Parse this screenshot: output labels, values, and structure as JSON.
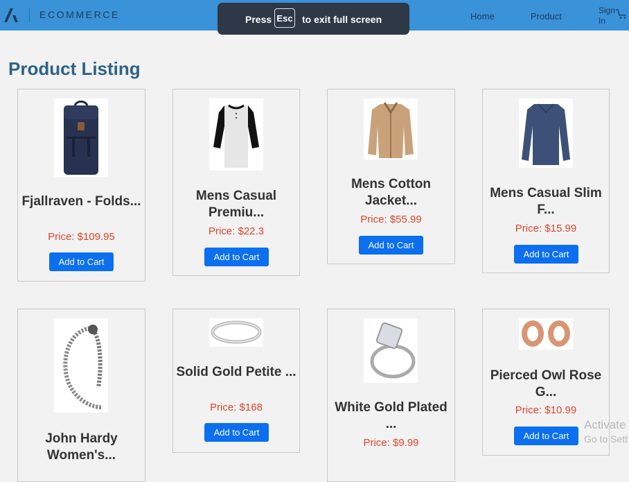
{
  "navbar": {
    "brand": "ECOMMERCE",
    "links": [
      "Home",
      "Product"
    ],
    "signin": "Sign In",
    "color": "#3a92d8"
  },
  "fullscreen_banner": {
    "press": "Press",
    "key": "Esc",
    "rest": "to exit full screen"
  },
  "page_title": "Product Listing",
  "products": [
    {
      "name": "Fjallraven - Folds...",
      "price": "Price: $109.95",
      "button": "Add to Cart",
      "icon": "backpack"
    },
    {
      "name": "Mens Casual Premiu...",
      "price": "Price: $22.3",
      "button": "Add to Cart",
      "icon": "raglan-tshirt"
    },
    {
      "name": "Mens Cotton Jacket...",
      "price": "Price: $55.99",
      "button": "Add to Cart",
      "icon": "jacket"
    },
    {
      "name": "Mens Casual Slim F...",
      "price": "Price: $15.99",
      "button": "Add to Cart",
      "icon": "long-sleeve-shirt"
    },
    {
      "name": "John Hardy Women's...",
      "price": "",
      "button": "",
      "icon": "bracelet"
    },
    {
      "name": "Solid Gold Petite ...",
      "price": "Price: $168",
      "button": "Add to Cart",
      "icon": "ring"
    },
    {
      "name": "White Gold Plated ...",
      "price": "Price: $9.99",
      "button": "",
      "icon": "diamond-ring"
    },
    {
      "name": "Pierced Owl Rose G...",
      "price": "Price: $10.99",
      "button": "Add to Cart",
      "icon": "plugs"
    }
  ],
  "watermark": {
    "line1": "Activate",
    "line2": "Go to Sett"
  },
  "colors": {
    "accent": "#0b6ff0",
    "price": "#e0432b",
    "title": "#2d6289"
  }
}
